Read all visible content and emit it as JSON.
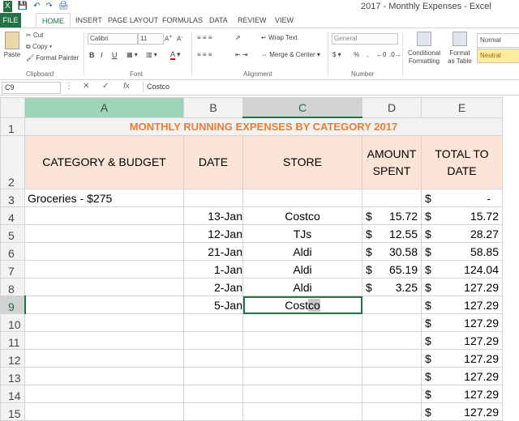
{
  "window": {
    "title": "2017 - Monthly Expenses - Excel"
  },
  "tabs": [
    "FILE",
    "HOME",
    "INSERT",
    "PAGE LAYOUT",
    "FORMULAS",
    "DATA",
    "REVIEW",
    "VIEW"
  ],
  "ribbon": {
    "clipboard": {
      "paste": "Paste",
      "cut": "Cut",
      "copy": "Copy",
      "format_painter": "Format Painter",
      "label": "Clipboard"
    },
    "font": {
      "name": "Calibri",
      "size": "11",
      "bold": "B",
      "italic": "I",
      "underline": "U",
      "label": "Font"
    },
    "alignment": {
      "wrap": "Wrap Text",
      "merge": "Merge & Center",
      "label": "Alignment"
    },
    "number": {
      "format": "General",
      "dollar": "$",
      "percent": "%",
      "comma": ",",
      "label": "Number"
    },
    "styles": {
      "conditional": "Conditional Formatting",
      "format_table": "Format as Table",
      "normal": "Normal",
      "neutral": "Neutral"
    }
  },
  "formula_bar": {
    "name_box": "C9",
    "cancel": "✕",
    "enter": "✓",
    "fx": "fx",
    "content": "Costco"
  },
  "columns": [
    "A",
    "B",
    "C",
    "D",
    "E"
  ],
  "rows": [
    "1",
    "2",
    "3",
    "4",
    "5",
    "6",
    "7",
    "8",
    "9",
    "10",
    "11",
    "12",
    "13",
    "14",
    "15"
  ],
  "sheet": {
    "title": "MONTHLY RUNNING EXPENSES BY CATEGORY 2017",
    "headers": {
      "a": "CATEGORY & BUDGET",
      "b": "DATE",
      "c": "STORE",
      "d": "AMOUNT SPENT",
      "e": "TOTAL TO DATE"
    },
    "category": "Groceries - $275",
    "currency": "$",
    "dash": "-",
    "entries": [
      {
        "date": "13-Jan",
        "store": "Costco",
        "amount": "15.72",
        "total": "15.72"
      },
      {
        "date": "12-Jan",
        "store": "TJs",
        "amount": "12.55",
        "total": "28.27"
      },
      {
        "date": "21-Jan",
        "store": "Aldi",
        "amount": "30.58",
        "total": "58.85"
      },
      {
        "date": "1-Jan",
        "store": "Aldi",
        "amount": "65.19",
        "total": "124.04"
      },
      {
        "date": "2-Jan",
        "store": "Aldi",
        "amount": "3.25",
        "total": "127.29"
      },
      {
        "date": "5-Jan",
        "store": "Costco",
        "amount": "",
        "total": "127.29"
      }
    ],
    "row9_store_start": "Cost",
    "row9_store_end": "co",
    "running_total": "127.29"
  }
}
